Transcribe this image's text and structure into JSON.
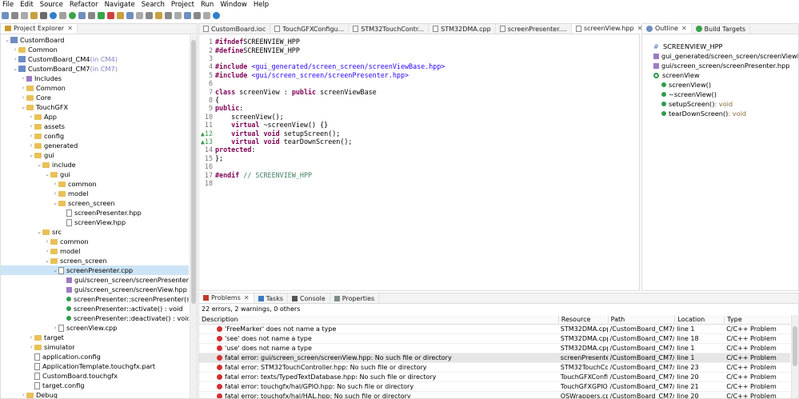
{
  "menu": [
    "File",
    "Edit",
    "Source",
    "Refactor",
    "Navigate",
    "Search",
    "Project",
    "Run",
    "Window",
    "Help"
  ],
  "explorer": {
    "title": "Project Explorer",
    "items": [
      {
        "label": "CustomBoard",
        "suffix": "",
        "depth": 0,
        "icon": "project",
        "arrow": "v"
      },
      {
        "label": "Common",
        "suffix": "",
        "depth": 1,
        "icon": "folder",
        "arrow": ">"
      },
      {
        "label": "CustomBoard_CM4",
        "suffix": " (in CM4)",
        "depth": 1,
        "icon": "project",
        "arrow": ">"
      },
      {
        "label": "CustomBoard_CM7",
        "suffix": " (in CM7)",
        "depth": 1,
        "icon": "project",
        "arrow": "v"
      },
      {
        "label": "Includes",
        "suffix": "",
        "depth": 2,
        "icon": "include",
        "arrow": ">"
      },
      {
        "label": "Common",
        "suffix": "",
        "depth": 2,
        "icon": "folder",
        "arrow": ">"
      },
      {
        "label": "Core",
        "suffix": "",
        "depth": 2,
        "icon": "folder",
        "arrow": ">"
      },
      {
        "label": "TouchGFX",
        "suffix": "",
        "depth": 2,
        "icon": "folder",
        "arrow": "v"
      },
      {
        "label": "App",
        "suffix": "",
        "depth": 3,
        "icon": "folder",
        "arrow": ">"
      },
      {
        "label": "assets",
        "suffix": "",
        "depth": 3,
        "icon": "folder",
        "arrow": ">"
      },
      {
        "label": "config",
        "suffix": "",
        "depth": 3,
        "icon": "folder",
        "arrow": ">"
      },
      {
        "label": "generated",
        "suffix": "",
        "depth": 3,
        "icon": "folder",
        "arrow": ">"
      },
      {
        "label": "gui",
        "suffix": "",
        "depth": 3,
        "icon": "folder",
        "arrow": "v"
      },
      {
        "label": "include",
        "suffix": "",
        "depth": 4,
        "icon": "folder",
        "arrow": "v"
      },
      {
        "label": "gui",
        "suffix": "",
        "depth": 5,
        "icon": "folder",
        "arrow": "v"
      },
      {
        "label": "common",
        "suffix": "",
        "depth": 6,
        "icon": "folder",
        "arrow": ">"
      },
      {
        "label": "model",
        "suffix": "",
        "depth": 6,
        "icon": "folder",
        "arrow": ">"
      },
      {
        "label": "screen_screen",
        "suffix": "",
        "depth": 6,
        "icon": "folder",
        "arrow": "v"
      },
      {
        "label": "screenPresenter.hpp",
        "suffix": "",
        "depth": 7,
        "icon": "file",
        "arrow": ""
      },
      {
        "label": "screenView.hpp",
        "suffix": "",
        "depth": 7,
        "icon": "file",
        "arrow": ""
      },
      {
        "label": "src",
        "suffix": "",
        "depth": 4,
        "icon": "folder",
        "arrow": "v"
      },
      {
        "label": "common",
        "suffix": "",
        "depth": 5,
        "icon": "folder",
        "arrow": ">"
      },
      {
        "label": "model",
        "suffix": "",
        "depth": 5,
        "icon": "folder",
        "arrow": ">"
      },
      {
        "label": "screen_screen",
        "suffix": "",
        "depth": 5,
        "icon": "folder",
        "arrow": "v"
      },
      {
        "label": "screenPresenter.cpp",
        "suffix": "",
        "depth": 6,
        "icon": "file",
        "arrow": "v",
        "selected": true
      },
      {
        "label": "gui/screen_screen/screenPresenter.hpp",
        "suffix": "",
        "depth": 7,
        "icon": "include",
        "arrow": ""
      },
      {
        "label": "gui/screen_screen/screenView.hpp",
        "suffix": "",
        "depth": 7,
        "icon": "include",
        "arrow": ""
      },
      {
        "label": "screenPresenter::screenPresenter(screenV",
        "suffix": "",
        "depth": 7,
        "icon": "dot",
        "arrow": ""
      },
      {
        "label": "screenPresenter::activate() : void",
        "suffix": "",
        "depth": 7,
        "icon": "dot",
        "arrow": ""
      },
      {
        "label": "screenPresenter::deactivate() : void",
        "suffix": "",
        "depth": 7,
        "icon": "dot",
        "arrow": ""
      },
      {
        "label": "screenView.cpp",
        "suffix": "",
        "depth": 6,
        "icon": "file",
        "arrow": ">"
      },
      {
        "label": "target",
        "suffix": "",
        "depth": 3,
        "icon": "folder",
        "arrow": ">"
      },
      {
        "label": "simulator",
        "suffix": "",
        "depth": 3,
        "icon": "folder",
        "arrow": ">"
      },
      {
        "label": "application.config",
        "suffix": "",
        "depth": 3,
        "icon": "file",
        "arrow": ""
      },
      {
        "label": "ApplicationTemplate.touchgfx.part",
        "suffix": "",
        "depth": 3,
        "icon": "file",
        "arrow": ""
      },
      {
        "label": "CustomBoard.touchgfx",
        "suffix": "",
        "depth": 3,
        "icon": "file",
        "arrow": ""
      },
      {
        "label": "target.config",
        "suffix": "",
        "depth": 3,
        "icon": "file",
        "arrow": ""
      },
      {
        "label": "Debug",
        "suffix": "",
        "depth": 2,
        "icon": "folder",
        "arrow": ">"
      }
    ]
  },
  "editor": {
    "tabs": [
      "CustomBoard.ioc",
      "TouchGFXConfigu...",
      "STM32TouchContr...",
      "STM32DMA.cpp",
      "screenPresenter....",
      "screenView.hpp"
    ],
    "active_tab": 5,
    "lines": [
      {
        "n": "1",
        "parts": [
          [
            "kw",
            "#ifndef"
          ],
          [
            "",
            "SCREENVIEW_HPP"
          ]
        ]
      },
      {
        "n": "2",
        "parts": [
          [
            "kw",
            "#define"
          ],
          [
            "",
            "SCREENVIEW_HPP"
          ]
        ]
      },
      {
        "n": "3",
        "parts": []
      },
      {
        "n": "4",
        "parts": [
          [
            "kw",
            "#include"
          ],
          [
            "str",
            "<gui_generated/screen_screen/screenViewBase.hpp>"
          ]
        ]
      },
      {
        "n": "5",
        "parts": [
          [
            "kw",
            "#include"
          ],
          [
            "str",
            "<gui/screen_screen/screenPresenter.hpp>"
          ]
        ]
      },
      {
        "n": "6",
        "parts": []
      },
      {
        "n": "7",
        "parts": [
          [
            "kw",
            "class"
          ],
          [
            "",
            " screenView : "
          ],
          [
            "kw",
            "public"
          ],
          [
            "",
            " screenViewBase"
          ]
        ]
      },
      {
        "n": "8",
        "parts": [
          [
            "",
            "{"
          ]
        ]
      },
      {
        "n": "9",
        "parts": [
          [
            "kw",
            "public"
          ],
          [
            "",
            ":"
          ]
        ]
      },
      {
        "n": "10",
        "parts": [
          [
            "",
            "    screenView();"
          ]
        ]
      },
      {
        "n": "11",
        "parts": [
          [
            "",
            "    "
          ],
          [
            "kw",
            "virtual"
          ],
          [
            "",
            " ~screenView() {}"
          ]
        ]
      },
      {
        "n": "12",
        "parts": [
          [
            "",
            "    "
          ],
          [
            "kw",
            "virtual void"
          ],
          [
            "",
            " setupScreen();"
          ]
        ],
        "marker": true
      },
      {
        "n": "13",
        "parts": [
          [
            "",
            "    "
          ],
          [
            "kw",
            "virtual void"
          ],
          [
            "",
            " tearDownScreen();"
          ]
        ],
        "marker": true
      },
      {
        "n": "14",
        "parts": [
          [
            "kw",
            "protected"
          ],
          [
            "",
            ":"
          ]
        ]
      },
      {
        "n": "15",
        "parts": [
          [
            "",
            "};"
          ]
        ]
      },
      {
        "n": "16",
        "parts": []
      },
      {
        "n": "17",
        "parts": [
          [
            "kw",
            "#endif"
          ],
          [
            "cm",
            " // SCREENVIEW_HPP"
          ]
        ]
      },
      {
        "n": "18",
        "parts": []
      }
    ]
  },
  "outline": {
    "tabs": [
      "Outline",
      "Build Targets"
    ],
    "items": [
      {
        "label": "SCREENVIEW_HPP",
        "type": "",
        "depth": 0,
        "icon": "hash"
      },
      {
        "label": "gui_generated/screen_screen/screenViewBase",
        "type": "",
        "depth": 0,
        "icon": "include"
      },
      {
        "label": "gui/screen_screen/screenPresenter.hpp",
        "type": "",
        "depth": 0,
        "icon": "include"
      },
      {
        "label": "screenView",
        "type": "",
        "depth": 0,
        "icon": "class"
      },
      {
        "label": "screenView()",
        "type": "",
        "depth": 1,
        "icon": "dot"
      },
      {
        "label": "~screenView()",
        "type": "",
        "depth": 1,
        "icon": "dot"
      },
      {
        "label": "setupScreen()",
        "type": " : void",
        "depth": 1,
        "icon": "dot"
      },
      {
        "label": "tearDownScreen()",
        "type": " : void",
        "depth": 1,
        "icon": "dot"
      }
    ]
  },
  "problems": {
    "tabs": [
      "Problems",
      "Tasks",
      "Console",
      "Properties"
    ],
    "summary": "22 errors, 2 warnings, 0 others",
    "columns": [
      "Description",
      "Resource",
      "Path",
      "Location",
      "Type"
    ],
    "rows": [
      {
        "desc": "'FreeMarker' does not name a type",
        "res": "STM32DMA.cpp",
        "path": "/CustomBoard_CM7/...",
        "loc": "line 1",
        "type": "C/C++ Problem"
      },
      {
        "desc": "'see' does not name a type",
        "res": "STM32DMA.cpp",
        "path": "/CustomBoard_CM7/...",
        "loc": "line 18",
        "type": "C/C++ Problem"
      },
      {
        "desc": "'use' does not name a type",
        "res": "STM32DMA.cpp",
        "path": "/CustomBoard_CM7/...",
        "loc": "line 1",
        "type": "C/C++ Problem"
      },
      {
        "desc": "fatal error: gui/screen_screen/screenView.hpp: No such file or directory",
        "res": "screenPresenter.cpp",
        "path": "/CustomBoard_CM7/...",
        "loc": "line 1",
        "type": "C/C++ Problem",
        "selected": true
      },
      {
        "desc": "fatal error: STM32TouchController.hpp: No such file or directory",
        "res": "STM32TouchCon...",
        "path": "/CustomBoard_CM7/...",
        "loc": "line 23",
        "type": "C/C++ Problem"
      },
      {
        "desc": "fatal error: texts/TypedTextDatabase.hpp: No such file or directory",
        "res": "TouchGFXConfi...",
        "path": "/CustomBoard_CM7/...",
        "loc": "line 20",
        "type": "C/C++ Problem"
      },
      {
        "desc": "fatal error: touchgfx/hal/GPIO.hpp: No such file or directory",
        "res": "TouchGFXGPIO....",
        "path": "/CustomBoard_CM7/...",
        "loc": "line 21",
        "type": "C/C++ Problem"
      },
      {
        "desc": "fatal error: touchgfx/hal/HAL.hpp: No such file or directory",
        "res": "OSWrappers.cpp",
        "path": "/CustomBoard_CM7/...",
        "loc": "line 20",
        "type": "C/C++ Problem"
      }
    ]
  }
}
